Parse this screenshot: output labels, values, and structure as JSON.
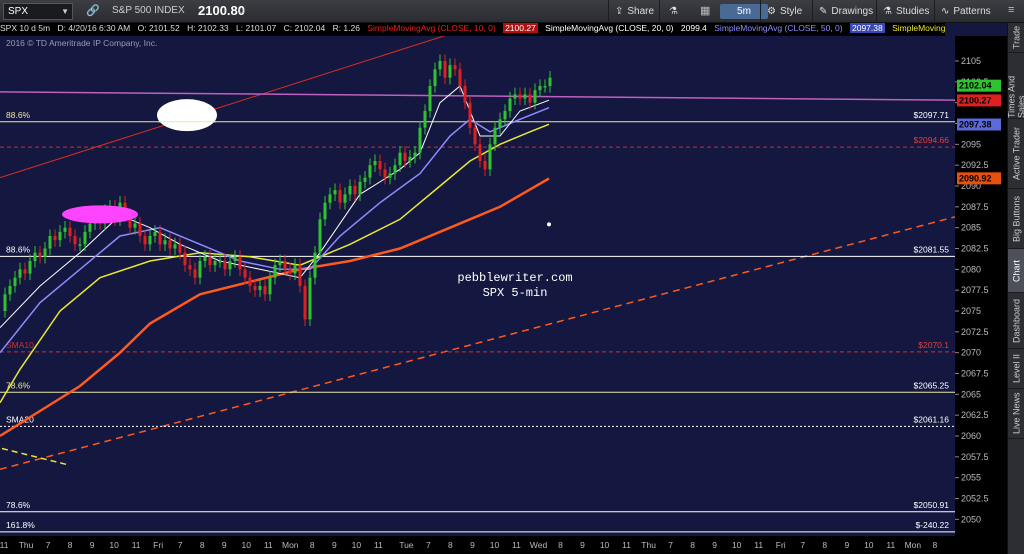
{
  "toolbar": {
    "symbol": "SPX",
    "description": "S&P 500 INDEX",
    "last_price": "2100.80",
    "share_label": "Share",
    "period_label": "5m",
    "style_label": "Style",
    "drawings_label": "Drawings",
    "studies_label": "Studies",
    "patterns_label": "Patterns"
  },
  "info_bar": {
    "title": "SPX 10 d 5m",
    "date": "D: 4/20/16 6:30 AM",
    "open": "O: 2101.52",
    "high": "H: 2102.33",
    "low": "L: 2101.07",
    "close": "C: 2102.04",
    "range": "R: 1.26",
    "sma10": "SimpleMovingAvg (CLOSE, 10, 0)",
    "sma10_val": "2100.27",
    "sma20": "SimpleMovingAvg (CLOSE, 20, 0)",
    "sma20_val": "2099.4",
    "sma50": "SimpleMovingAvg (CLOSE, 50, 0)",
    "sma50_val": "2097.38",
    "sma_more": "SimpleMoving..."
  },
  "copyright": "2016 © TD Ameritrade IP Company, Inc.",
  "watermark": {
    "line1": "pebblewriter.com",
    "line2": "SPX 5-min"
  },
  "sidebar": {
    "tabs": [
      "Trade",
      "Times And Sales",
      "Active Trader",
      "Big Buttons",
      "Chart",
      "Dashboard",
      "Level II",
      "Live News"
    ]
  },
  "colors": {
    "background": "#14173f",
    "price_up": "#2fc42f",
    "price_down": "#e02020",
    "sma10": "#ffffff",
    "sma20": "#8c8cff",
    "sma50": "#e8e830",
    "sma200": "#ff5a1e",
    "level_line": "#e8e8a0",
    "magenta": "#c060c0"
  },
  "chart_data": {
    "type": "line",
    "y_axis": {
      "min": 2048,
      "max": 2108,
      "step": 2.5
    },
    "y_ticks": [
      "2105",
      "2102.5",
      "2100",
      "2097.5",
      "2095",
      "2092.5",
      "2090",
      "2087.5",
      "2085",
      "2082.5",
      "2080",
      "2077.5",
      "2075",
      "2072.5",
      "2070",
      "2067.5",
      "2065",
      "2062.5",
      "2060",
      "2057.5",
      "2055",
      "2052.5",
      "2050"
    ],
    "x_ticks": [
      "11",
      "Thu",
      "7",
      "8",
      "9",
      "10",
      "11",
      "Fri",
      "7",
      "8",
      "9",
      "10",
      "11",
      "Mon",
      "8",
      "9",
      "10",
      "11",
      "Tue",
      "7",
      "8",
      "9",
      "10",
      "11",
      "Wed",
      "8",
      "9",
      "10",
      "11",
      "Thu",
      "7",
      "8",
      "9",
      "10",
      "11",
      "Fri",
      "7",
      "8",
      "9",
      "10",
      "11",
      "Mon",
      "8"
    ],
    "price_labels": [
      {
        "value": 2102.04,
        "text": "2102.04",
        "color": "#2fc42f"
      },
      {
        "value": 2100.27,
        "text": "2100.27",
        "color": "#e02020"
      },
      {
        "value": 2097.38,
        "text": "2097.38",
        "color": "#5a6ad8"
      },
      {
        "value": 2090.92,
        "text": "2090.92",
        "color": "#e8500e"
      }
    ],
    "levels": [
      {
        "value": 2097.71,
        "left": "88.6%",
        "right": "$2097.71",
        "color": "#e8e8a0",
        "style": "solid"
      },
      {
        "value": 2094.66,
        "left": "",
        "right": "$2094.66",
        "color": "#d03030",
        "style": "dashed"
      },
      {
        "value": 2081.55,
        "left": "88.6%",
        "right": "$2081.55",
        "color": "#ffffff",
        "style": "solid"
      },
      {
        "value": 2070.1,
        "left": "SMA10",
        "right": "$2070.1",
        "color": "#d03030",
        "style": "dashed"
      },
      {
        "value": 2065.25,
        "left": "78.6%",
        "right": "$2065.25",
        "color": "#e8e8a0",
        "style": "solid"
      },
      {
        "value": 2061.16,
        "left": "SMA20",
        "right": "$2061.16",
        "color": "#ffffff",
        "style": "dotted"
      },
      {
        "value": 2050.91,
        "left": "78.6%",
        "right": "$2050.91",
        "color": "#ffffff",
        "style": "solid"
      },
      {
        "value": 2048.5,
        "left": "161.8%",
        "right": "$-240.22",
        "color": "#ffffff",
        "style": "solid"
      }
    ],
    "price_path": [
      [
        0,
        2075
      ],
      [
        5,
        2077
      ],
      [
        10,
        2078
      ],
      [
        15,
        2079
      ],
      [
        20,
        2080
      ],
      [
        25,
        2079.5
      ],
      [
        30,
        2081
      ],
      [
        35,
        2082
      ],
      [
        40,
        2081.5
      ],
      [
        45,
        2082.5
      ],
      [
        50,
        2084
      ],
      [
        55,
        2083.5
      ],
      [
        60,
        2084.5
      ],
      [
        65,
        2085
      ],
      [
        70,
        2084
      ],
      [
        75,
        2083
      ],
      [
        80,
        2083
      ],
      [
        85,
        2084.5
      ],
      [
        90,
        2085.5
      ],
      [
        95,
        2086
      ],
      [
        100,
        2085.5
      ],
      [
        105,
        2087
      ],
      [
        110,
        2087.5
      ],
      [
        115,
        2086
      ],
      [
        120,
        2088
      ],
      [
        125,
        2086.5
      ],
      [
        130,
        2085
      ],
      [
        135,
        2085.5
      ],
      [
        140,
        2084
      ],
      [
        145,
        2083
      ],
      [
        150,
        2084
      ],
      [
        155,
        2084.5
      ],
      [
        160,
        2083
      ],
      [
        165,
        2083.5
      ],
      [
        170,
        2082.5
      ],
      [
        175,
        2083
      ],
      [
        180,
        2082
      ],
      [
        185,
        2080.5
      ],
      [
        190,
        2080
      ],
      [
        195,
        2079
      ],
      [
        200,
        2081
      ],
      [
        205,
        2081.5
      ],
      [
        210,
        2080.5
      ],
      [
        215,
        2081
      ],
      [
        220,
        2081
      ],
      [
        225,
        2080
      ],
      [
        230,
        2081
      ],
      [
        235,
        2081.5
      ],
      [
        240,
        2080
      ],
      [
        245,
        2079
      ],
      [
        250,
        2078
      ],
      [
        255,
        2077.5
      ],
      [
        260,
        2078
      ],
      [
        265,
        2077
      ],
      [
        270,
        2079
      ],
      [
        275,
        2080.5
      ],
      [
        280,
        2081
      ],
      [
        285,
        2080
      ],
      [
        290,
        2079.5
      ],
      [
        295,
        2080.5
      ],
      [
        300,
        2078
      ],
      [
        305,
        2074
      ],
      [
        310,
        2079
      ],
      [
        315,
        2082
      ],
      [
        320,
        2086
      ],
      [
        325,
        2088
      ],
      [
        330,
        2089
      ],
      [
        335,
        2089.5
      ],
      [
        340,
        2088
      ],
      [
        345,
        2089
      ],
      [
        350,
        2090
      ],
      [
        355,
        2089
      ],
      [
        360,
        2090.5
      ],
      [
        365,
        2091
      ],
      [
        370,
        2092.5
      ],
      [
        375,
        2093
      ],
      [
        380,
        2092
      ],
      [
        385,
        2091
      ],
      [
        390,
        2091.5
      ],
      [
        395,
        2092.5
      ],
      [
        400,
        2094
      ],
      [
        405,
        2093
      ],
      [
        410,
        2093.5
      ],
      [
        415,
        2094
      ],
      [
        420,
        2097
      ],
      [
        425,
        2099
      ],
      [
        430,
        2102
      ],
      [
        435,
        2104
      ],
      [
        440,
        2105
      ],
      [
        445,
        2103
      ],
      [
        450,
        2104.5
      ],
      [
        455,
        2104
      ],
      [
        460,
        2102
      ],
      [
        465,
        2100
      ],
      [
        470,
        2097
      ],
      [
        475,
        2095
      ],
      [
        480,
        2093
      ],
      [
        485,
        2092
      ],
      [
        490,
        2095
      ],
      [
        495,
        2097
      ],
      [
        500,
        2098
      ],
      [
        505,
        2099
      ],
      [
        510,
        2100.5
      ],
      [
        515,
        2101
      ],
      [
        520,
        2100.5
      ],
      [
        525,
        2101
      ],
      [
        530,
        2100
      ],
      [
        535,
        2101.5
      ],
      [
        540,
        2102
      ],
      [
        545,
        2102
      ],
      [
        550,
        2103
      ]
    ],
    "sma10_path": [
      [
        0,
        2073
      ],
      [
        40,
        2078
      ],
      [
        80,
        2082
      ],
      [
        120,
        2086.5
      ],
      [
        150,
        2085
      ],
      [
        180,
        2083
      ],
      [
        220,
        2081
      ],
      [
        260,
        2080
      ],
      [
        300,
        2079
      ],
      [
        320,
        2082
      ],
      [
        360,
        2089
      ],
      [
        400,
        2092
      ],
      [
        420,
        2094
      ],
      [
        440,
        2100
      ],
      [
        460,
        2102
      ],
      [
        480,
        2096
      ],
      [
        500,
        2096
      ],
      [
        520,
        2099
      ],
      [
        549,
        2100.3
      ]
    ],
    "sma20_path": [
      [
        0,
        2070
      ],
      [
        40,
        2076
      ],
      [
        80,
        2080
      ],
      [
        120,
        2084
      ],
      [
        160,
        2085
      ],
      [
        200,
        2083
      ],
      [
        240,
        2081
      ],
      [
        280,
        2080
      ],
      [
        310,
        2080
      ],
      [
        340,
        2084
      ],
      [
        380,
        2088
      ],
      [
        420,
        2091.5
      ],
      [
        450,
        2096
      ],
      [
        470,
        2098
      ],
      [
        490,
        2096.5
      ],
      [
        520,
        2098
      ],
      [
        549,
        2099.4
      ]
    ],
    "sma50_path": [
      [
        0,
        2064
      ],
      [
        20,
        2068
      ],
      [
        60,
        2075
      ],
      [
        100,
        2079
      ],
      [
        150,
        2081
      ],
      [
        200,
        2082
      ],
      [
        250,
        2081.5
      ],
      [
        300,
        2080.5
      ],
      [
        350,
        2083
      ],
      [
        400,
        2086
      ],
      [
        440,
        2090
      ],
      [
        470,
        2093
      ],
      [
        500,
        2095
      ],
      [
        530,
        2096.5
      ],
      [
        549,
        2097.4
      ]
    ],
    "sma200_path": [
      [
        0,
        2060
      ],
      [
        40,
        2063
      ],
      [
        80,
        2066
      ],
      [
        120,
        2070
      ],
      [
        150,
        2073.5
      ],
      [
        200,
        2077
      ],
      [
        250,
        2078.5
      ],
      [
        300,
        2080
      ],
      [
        350,
        2081
      ],
      [
        400,
        2082.5
      ],
      [
        450,
        2085
      ],
      [
        500,
        2087.5
      ],
      [
        549,
        2090.9
      ]
    ]
  }
}
